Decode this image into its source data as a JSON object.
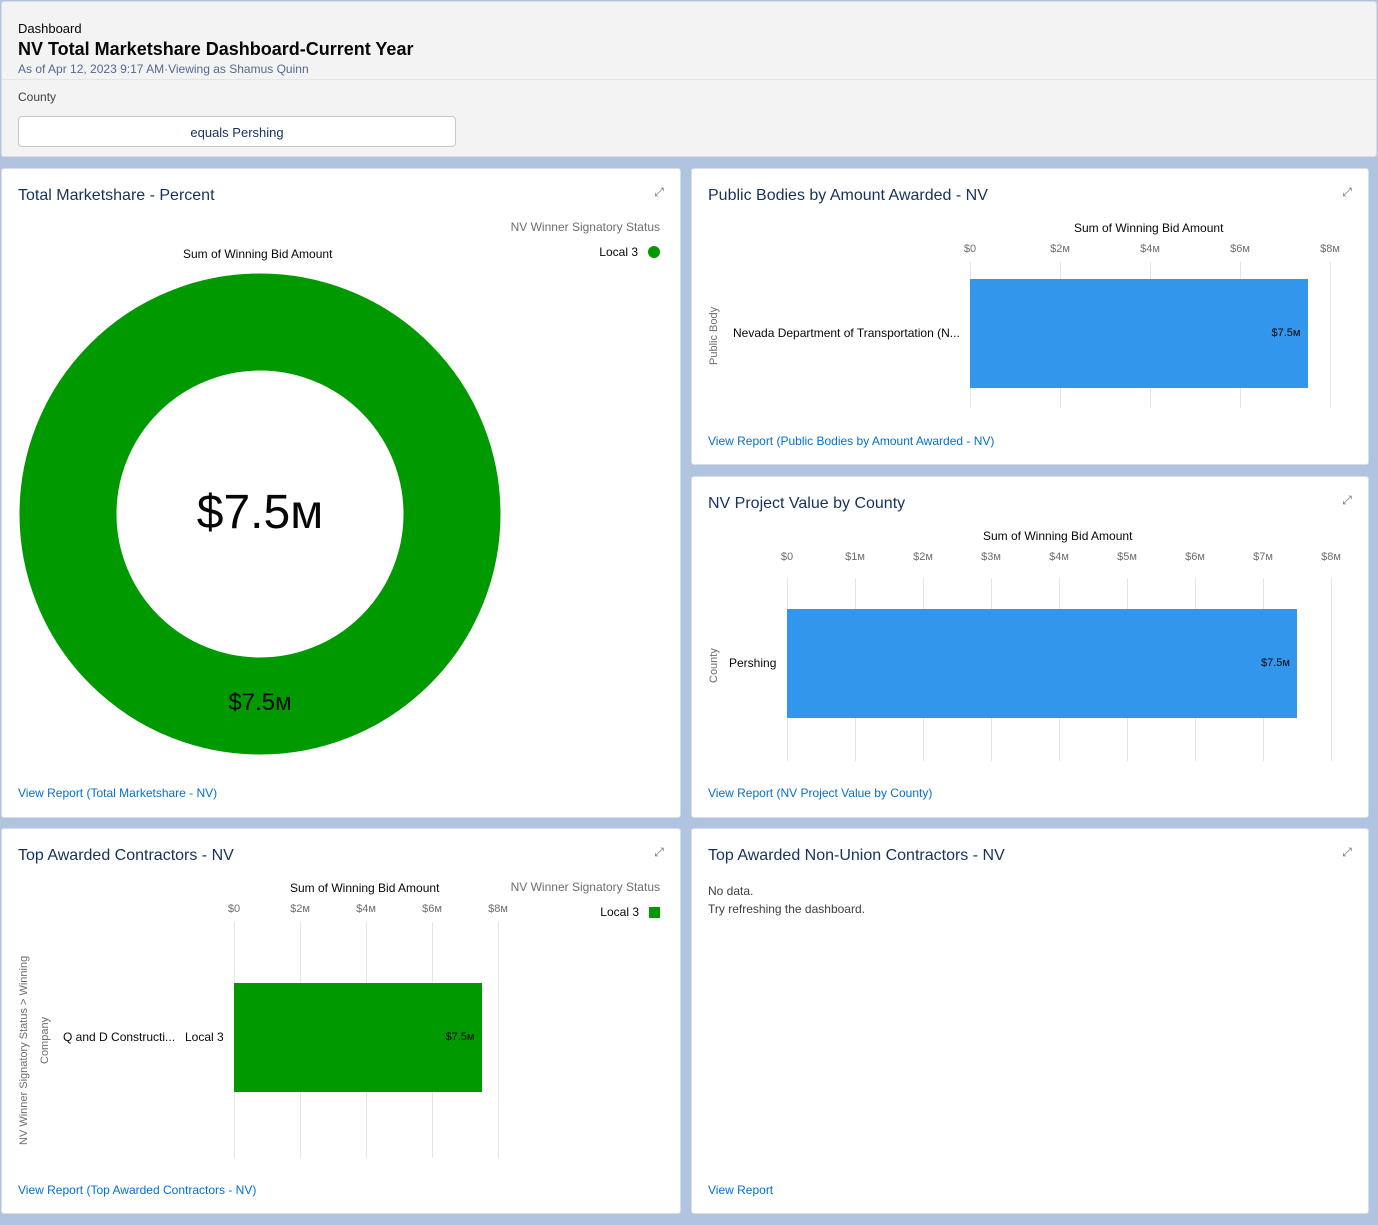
{
  "header": {
    "breadcrumb": "Dashboard",
    "title": "NV Total Marketshare Dashboard-Current Year",
    "as_of": "As of Apr 12, 2023 9:17 AM·Viewing as Shamus Quinn",
    "filter_label": "County",
    "filter_value": "equals Pershing"
  },
  "icons": {
    "expand": "expand-icon"
  },
  "colors": {
    "green": "#009900",
    "blue": "#3296ed",
    "link": "#0070d2"
  },
  "cards": {
    "marketshare": {
      "title": "Total Marketshare - Percent",
      "measure_title": "Sum of Winning Bid Amount",
      "legend_title": "NV Winner Signatory Status",
      "legend_item": "Local 3",
      "center_value": "$7.5м",
      "slice_label": "$7.5м",
      "view_report": "View Report (Total Marketshare - NV)"
    },
    "public_bodies": {
      "title": "Public Bodies by Amount Awarded - NV",
      "axis_title": "Sum of Winning Bid Amount",
      "y_axis_label": "Public Body",
      "view_report": "View Report (Public Bodies by Amount Awarded - NV)"
    },
    "project_value": {
      "title": "NV Project Value by County",
      "axis_title": "Sum of Winning Bid Amount",
      "y_axis_label": "County",
      "view_report": "View Report (NV Project Value by County)"
    },
    "top_contractors": {
      "title": "Top Awarded Contractors - NV",
      "axis_title": "Sum of Winning Bid Amount",
      "legend_title": "NV Winner Signatory Status",
      "legend_item": "Local 3",
      "y_axis_label_1": "NV Winner Signatory Status > Winning",
      "y_axis_label_2": "Company",
      "view_report": "View Report (Top Awarded Contractors - NV)"
    },
    "non_union": {
      "title": "Top Awarded Non-Union Contractors - NV",
      "no_data": "No data.",
      "hint": "Try refreshing the dashboard.",
      "view_report": "View Report"
    }
  },
  "chart_data": [
    {
      "type": "pie",
      "title": "Total Marketshare - Percent",
      "categories": [
        "Local 3"
      ],
      "values": [
        7.5
      ],
      "value_labels": [
        "$7.5м"
      ]
    },
    {
      "type": "bar",
      "title": "Public Bodies by Amount Awarded - NV",
      "xlabel": "Sum of Winning Bid Amount",
      "ylabel": "Public Body",
      "categories": [
        "Nevada Department of Transportation (N..."
      ],
      "values": [
        7.5
      ],
      "value_labels": [
        "$7.5м"
      ],
      "ticks": [
        "$0",
        "$2м",
        "$4м",
        "$6м",
        "$8м"
      ],
      "tick_values": [
        0,
        2,
        4,
        6,
        8
      ],
      "xlim": [
        0,
        8
      ]
    },
    {
      "type": "bar",
      "title": "NV Project Value by County",
      "xlabel": "Sum of Winning Bid Amount",
      "ylabel": "County",
      "categories": [
        "Pershing"
      ],
      "values": [
        7.5
      ],
      "value_labels": [
        "$7.5м"
      ],
      "ticks": [
        "$0",
        "$1м",
        "$2м",
        "$3м",
        "$4м",
        "$5м",
        "$6м",
        "$7м",
        "$8м"
      ],
      "tick_values": [
        0,
        1,
        2,
        3,
        4,
        5,
        6,
        7,
        8
      ],
      "xlim": [
        0,
        8
      ]
    },
    {
      "type": "bar",
      "title": "Top Awarded Contractors - NV",
      "xlabel": "Sum of Winning Bid Amount",
      "categories": [
        "Q and D Constructi..."
      ],
      "group_label": "Local 3",
      "values": [
        7.5
      ],
      "value_labels": [
        "$7.5м"
      ],
      "ticks": [
        "$0",
        "$2м",
        "$4м",
        "$6м",
        "$8м"
      ],
      "tick_values": [
        0,
        2,
        4,
        6,
        8
      ],
      "xlim": [
        0,
        8
      ]
    }
  ]
}
